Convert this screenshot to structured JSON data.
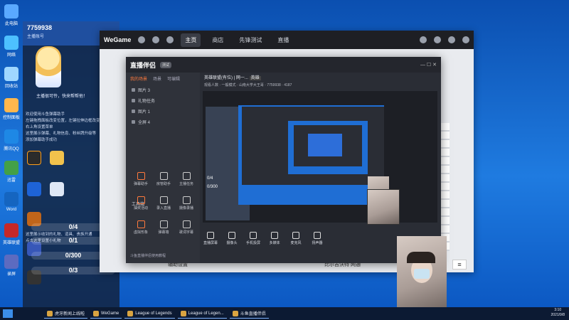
{
  "desktop": {
    "icons": [
      {
        "label": "此电脑",
        "color": "#5aa9ff"
      },
      {
        "label": "网络",
        "color": "#4dc0ff"
      },
      {
        "label": "回收站",
        "color": "#9fd7ff"
      },
      {
        "label": "控制面板",
        "color": "#ffb74d"
      },
      {
        "label": "腾讯QQ",
        "color": "#1e88e5"
      },
      {
        "label": "迅雷",
        "color": "#43a047"
      },
      {
        "label": "Word",
        "color": "#1565c0"
      },
      {
        "label": "英雄联盟",
        "color": "#c62828"
      },
      {
        "label": "录屏",
        "color": "#5c6bc0"
      }
    ]
  },
  "overlay": {
    "user_id": "7759938",
    "top_sub": "主播账号",
    "motto": "主播很可怜，快来帮帮他！",
    "lines": [
      "欢迎使用斗鱼弹幕助手",
      "左键拖拽面板改变位置，左键拉伸边框改变大小",
      "右上角设置菜单",
      "这里展示弹幕、礼物信息、粉丝牌升级等",
      "添加弹幕助手成功"
    ],
    "hint_lines": [
      "这里展示收到的礼物、道具、贵族开通",
      "点击这里设置小礼物"
    ],
    "counters": [
      "0/4",
      "0/1",
      "0/300",
      "0/3"
    ]
  },
  "wegame": {
    "logo": "WeGame",
    "tabs": [
      "主页",
      "商店",
      "先锋测试",
      "直播"
    ],
    "active_tab": "主页",
    "footer_left": "辅助设置",
    "footer_right": "比尔吉沃特 网通"
  },
  "companion": {
    "title": "直播伴侣",
    "badge": "测试",
    "tabs": [
      "我的场景",
      "场景",
      "可编辑"
    ],
    "scenes": [
      "图片 3",
      "礼物任务",
      "图片 1",
      "全屏 4"
    ],
    "room_title": "英雄联盟(有位) | 网一...",
    "room_tag": "英雄",
    "room_info": "观看人数 · 一般模式 · 山南大学大王哥 · 7759938 · 4187",
    "tools_title": "工具箱",
    "tools": [
      "弹幕助手",
      "房管助手",
      "主播任务",
      "抽奖活动",
      "录入直播",
      "摄像录播",
      "虚拟形象",
      "弹幕墙",
      "歌词字幕"
    ],
    "bottom_buttons": [
      "直播屏幕",
      "摄像头",
      "手机投屏",
      "多媒体",
      "麦克风",
      "扬声器"
    ],
    "status": "斗鱼直播伴侣使用教程"
  },
  "taskbar": {
    "items": [
      "虎牙新闻上线啦",
      "WeGame",
      "League of Legends",
      "League of Legen...",
      "斗鱼直播伴侣"
    ],
    "time": "3:10",
    "date": "2021/9/8"
  }
}
